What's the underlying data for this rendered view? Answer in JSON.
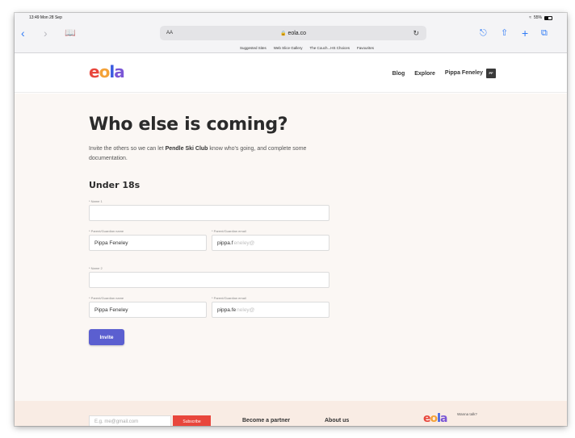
{
  "status": {
    "time": "13:49",
    "date": "Mon 28 Sep",
    "battery": "55%"
  },
  "browser": {
    "aa_label": "AA",
    "url": "eola.co",
    "favourites": [
      "Suggested Sites",
      "Web Slice Gallery",
      "The Couch...HS Choices",
      "Favourites"
    ]
  },
  "header": {
    "logo": [
      "e",
      "o",
      "l",
      "a"
    ],
    "nav": {
      "blog": "Blog",
      "explore": "Explore",
      "user": "Pippa Feneley",
      "initials": "PF"
    }
  },
  "main": {
    "title": "Who else is coming?",
    "intro_pre": "Invite the others so we can let ",
    "intro_club": "Pendle Ski Club",
    "intro_post": " know who's going, and complete some documentation.",
    "section": "Under 18s",
    "guests": [
      {
        "name_label": "* Name 1",
        "name_value": "",
        "guardian_name_label": "* Parent/Guardian name",
        "guardian_name_value": "Pippa Feneley",
        "guardian_email_label": "* Parent/Guardian email",
        "guardian_email_value": "pippa.f",
        "guardian_email_ghost": "eneley@"
      },
      {
        "name_label": "* Name 2",
        "name_value": "",
        "guardian_name_label": "* Parent/Guardian name",
        "guardian_name_value": "Pippa Feneley",
        "guardian_email_label": "* Parent/Guardian email",
        "guardian_email_value": "pippa.fe",
        "guardian_email_ghost": "neley@"
      }
    ],
    "invite_label": "Invite"
  },
  "footer": {
    "email_placeholder": "E.g. me@gmail.com",
    "subscribe_label": "Subscribe",
    "partner_link": "Become a partner",
    "about_link": "About us",
    "talk_text": "Wanna talk?"
  },
  "colors": {
    "accent": "#5b5fd0",
    "logo_e": "#e8463c",
    "logo_o": "#f4a238",
    "logo_l": "#3a5be0",
    "logo_a": "#7b57d6",
    "browser_blue": "#2f7bf6"
  }
}
